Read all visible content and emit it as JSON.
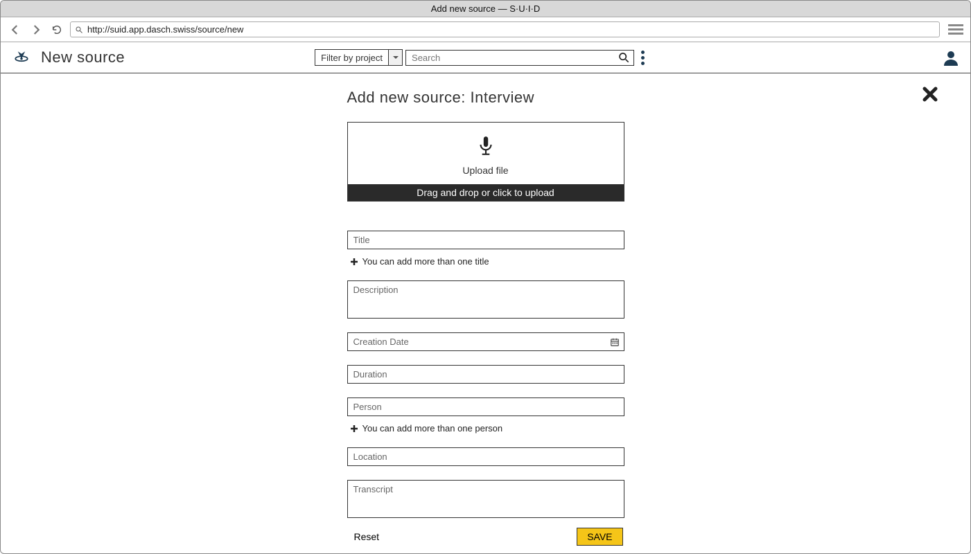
{
  "window": {
    "title": "Add new source — S·U·I·D"
  },
  "browser": {
    "url": "http://suid.app.dasch.swiss/source/new"
  },
  "header": {
    "page_title": "New source",
    "filter_label": "Filter by project",
    "search_placeholder": "Search"
  },
  "form": {
    "heading": "Add new source: Interview",
    "upload": {
      "label": "Upload file",
      "hint": "Drag and drop or click to upload"
    },
    "fields": {
      "title_placeholder": "Title",
      "title_hint": "You can add more than  one title",
      "description_placeholder": "Description",
      "creation_date_placeholder": "Creation Date",
      "duration_placeholder": "Duration",
      "person_placeholder": "Person",
      "person_hint": "You can add more than one person",
      "location_placeholder": "Location",
      "transcript_placeholder": "Transcript"
    },
    "actions": {
      "reset": "Reset",
      "save": "SAVE"
    }
  }
}
